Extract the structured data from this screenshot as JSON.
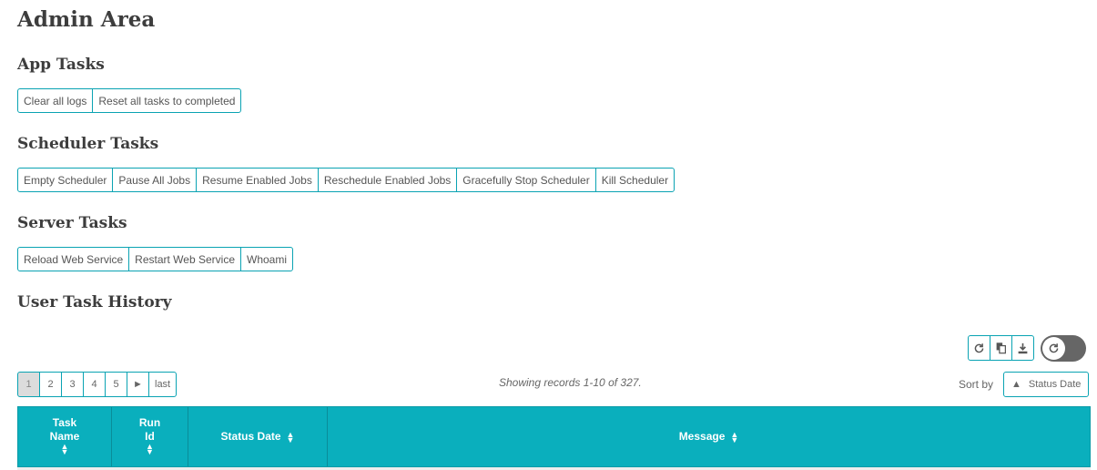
{
  "page": {
    "title": "Admin Area"
  },
  "app_tasks": {
    "heading": "App Tasks",
    "buttons": [
      "Clear all logs",
      "Reset all tasks to completed"
    ]
  },
  "scheduler_tasks": {
    "heading": "Scheduler Tasks",
    "buttons": [
      "Empty Scheduler",
      "Pause All Jobs",
      "Resume Enabled Jobs",
      "Reschedule Enabled Jobs",
      "Gracefully Stop Scheduler",
      "Kill Scheduler"
    ]
  },
  "server_tasks": {
    "heading": "Server Tasks",
    "buttons": [
      "Reload Web Service",
      "Restart Web Service",
      "Whoami"
    ]
  },
  "history": {
    "heading": "User Task History",
    "toolbar": {
      "icons": [
        "refresh-icon",
        "copy-icon",
        "download-icon"
      ],
      "auto_refresh_on": false
    },
    "pager": {
      "pages": [
        "1",
        "2",
        "3",
        "4",
        "5"
      ],
      "next": "►",
      "last": "last",
      "current": "1"
    },
    "showing": "Showing records 1-10 of 327.",
    "sort_label": "Sort by",
    "sort_value": "Status Date",
    "sort_arrow": "▲",
    "columns": [
      {
        "line1": "Task",
        "line2": "Name"
      },
      {
        "line1": "Run",
        "line2": "Id"
      },
      {
        "line1": "Status Date",
        "line2": ""
      },
      {
        "line1": "Message",
        "line2": ""
      }
    ]
  },
  "colors": {
    "accent": "#0aafbd",
    "border": "#0aa3b3"
  }
}
